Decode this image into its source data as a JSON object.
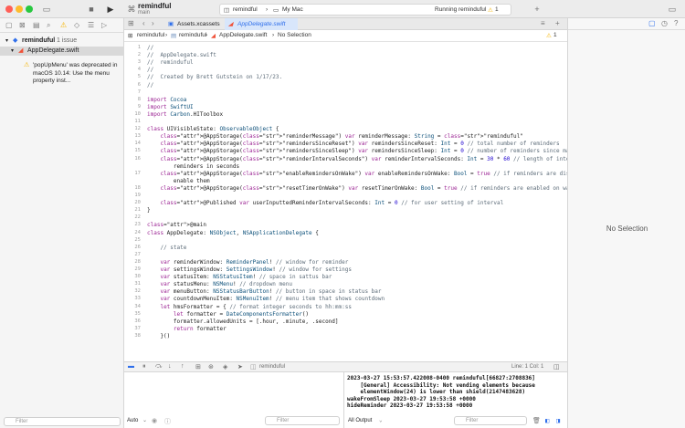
{
  "toolbar": {
    "scheme_title": "remindful",
    "scheme_branch": "main",
    "target_app": "remindful",
    "destination": "My Mac",
    "run_status": "Running reminduful",
    "warning_count": "1"
  },
  "navigator": {
    "project": "reminduful",
    "issue_count": "1 issue",
    "file": "AppDelegate.swift",
    "issue_message": "'popUpMenu' was deprecated in macOS 10.14: Use the menu property inst...",
    "filter_placeholder": "Filter"
  },
  "tabs": [
    {
      "label": "Assets.xcassets"
    },
    {
      "label": "AppDelegate.swift"
    }
  ],
  "jumpbar": {
    "project": "reminduful",
    "folder": "reminduful",
    "file": "AppDelegate.swift",
    "symbol": "No Selection"
  },
  "code_lines": [
    "//",
    "//  AppDelegate.swift",
    "//  reminduful",
    "//",
    "//  Created by Brett Gutstein on 1/17/23.",
    "//",
    "",
    "import Cocoa",
    "import SwiftUI",
    "import Carbon.HIToolbox",
    "",
    "class UIVisibleState: ObservableObject {",
    "    @AppStorage(\"reminderMessage\") var reminderMessage: String = \"reminduful\"",
    "    @AppStorage(\"remindersSinceReset\") var remindersSinceReset: Int = 0 // total number of reminders",
    "    @AppStorage(\"remindersSinceSleep\") var remindersSinceSleep: Int = 0 // number of reminders since machine last slept",
    "    @AppStorage(\"reminderIntervalSeconds\") var reminderIntervalSeconds: Int = 30 * 60 // length of interval between",
    "        reminders in seconds",
    "    @AppStorage(\"enableRemindersOnWake\") var enableRemindersOnWake: Bool = true // if reminders are disabled on wake,",
    "        enable them",
    "    @AppStorage(\"resetTimerOnWake\") var resetTimerOnWake: Bool = true // if reminders are enabled on wake, reset the timer",
    "",
    "    @Published var userInputtedReminderIntervalSeconds: Int = 0 // for user setting of interval",
    "}",
    "",
    "@main",
    "class AppDelegate: NSObject, NSApplicationDelegate {",
    "",
    "    // state",
    "",
    "    var reminderWindow: ReminderPanel! // window for reminder",
    "    var settingsWindow: SettingsWindow! // window for settings",
    "    var statusItem: NSStatusItem! // space in sattus bar",
    "    var statusMenu: NSMenu! // dropdown menu",
    "    var menuButton: NSStatusBarButton! // button in space in status bar",
    "    var countdownMenuItem: NSMenuItem! // menu item that shows countdown",
    "    let hmsFormatter = { // format integer seconds to hh:mm:ss",
    "        let formatter = DateComponentsFormatter()",
    "        formatter.allowedUnits = [.hour, .minute, .second]",
    "        return formatter",
    "    }()"
  ],
  "line_numbers": [
    "1",
    "2",
    "3",
    "4",
    "5",
    "6",
    "7",
    "8",
    "9",
    "10",
    "11",
    "12",
    "13",
    "14",
    "15",
    "16",
    "",
    "17",
    "",
    "18",
    "19",
    "20",
    "21",
    "22",
    "23",
    "24",
    "25",
    "26",
    "27",
    "28",
    "29",
    "30",
    "31",
    "32",
    "33",
    "34",
    "35",
    "36",
    "37",
    "38"
  ],
  "debug": {
    "target": "reminduful",
    "cursor": "Line: 1  Col: 1"
  },
  "console": {
    "lines": [
      "2023-03-27 15:53:57.422008-0400 reminduful[66827:2708836]",
      "    [General] Accessibility: Not vending elements because",
      "    elementWindow(24) is lower than shield(2147483628)",
      "wakeFromSleep 2023-03-27 19:53:58 +0000",
      "hideReminder 2023-03-27 19:53:58 +0000"
    ],
    "output_selector": "All Output",
    "filter_placeholder": "Filter",
    "auto_selector": "Auto"
  },
  "vars": {
    "filter_placeholder": "Filter"
  },
  "inspector": {
    "empty_text": "No Selection"
  },
  "colors": {
    "accent": "#2f6feb",
    "warning": "#f5b400",
    "selected_tab": "#d8e6fb"
  }
}
